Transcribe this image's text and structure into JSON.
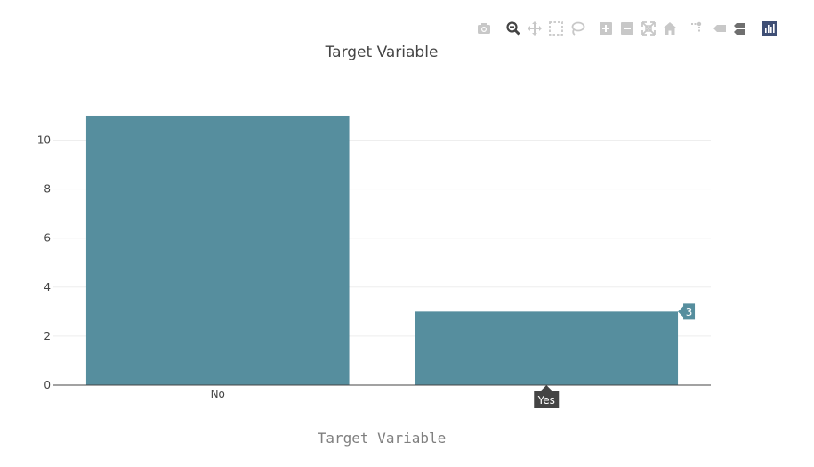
{
  "toolbar": {
    "icons": [
      "camera-icon",
      "zoom-icon",
      "pan-icon",
      "box-select-icon",
      "lasso-select-icon",
      "zoom-in-icon",
      "zoom-out-icon",
      "autoscale-icon",
      "reset-axes-icon",
      "spike-lines-icon",
      "hover-closest-icon",
      "hover-compare-icon",
      "plotly-logo-icon"
    ]
  },
  "chart_data": {
    "type": "bar",
    "title": "Target Variable",
    "xlabel": "Target Variable",
    "ylabel": "",
    "categories": [
      "No",
      "Yes"
    ],
    "values": [
      11,
      3
    ],
    "ylim": [
      0,
      11.58
    ],
    "yticks": [
      0,
      2,
      4,
      6,
      8,
      10
    ],
    "grid": true,
    "bar_color": "#568e9e",
    "hover": {
      "category": "Yes",
      "value_label": "3",
      "axis_label": "Yes"
    }
  },
  "colors": {
    "bar": "#568e9e",
    "grid": "#eeeeee",
    "axis": "#444444",
    "tooltip": "#444444",
    "modebar_active": "#444444",
    "modebar_inactive": "#c8c8c8"
  }
}
